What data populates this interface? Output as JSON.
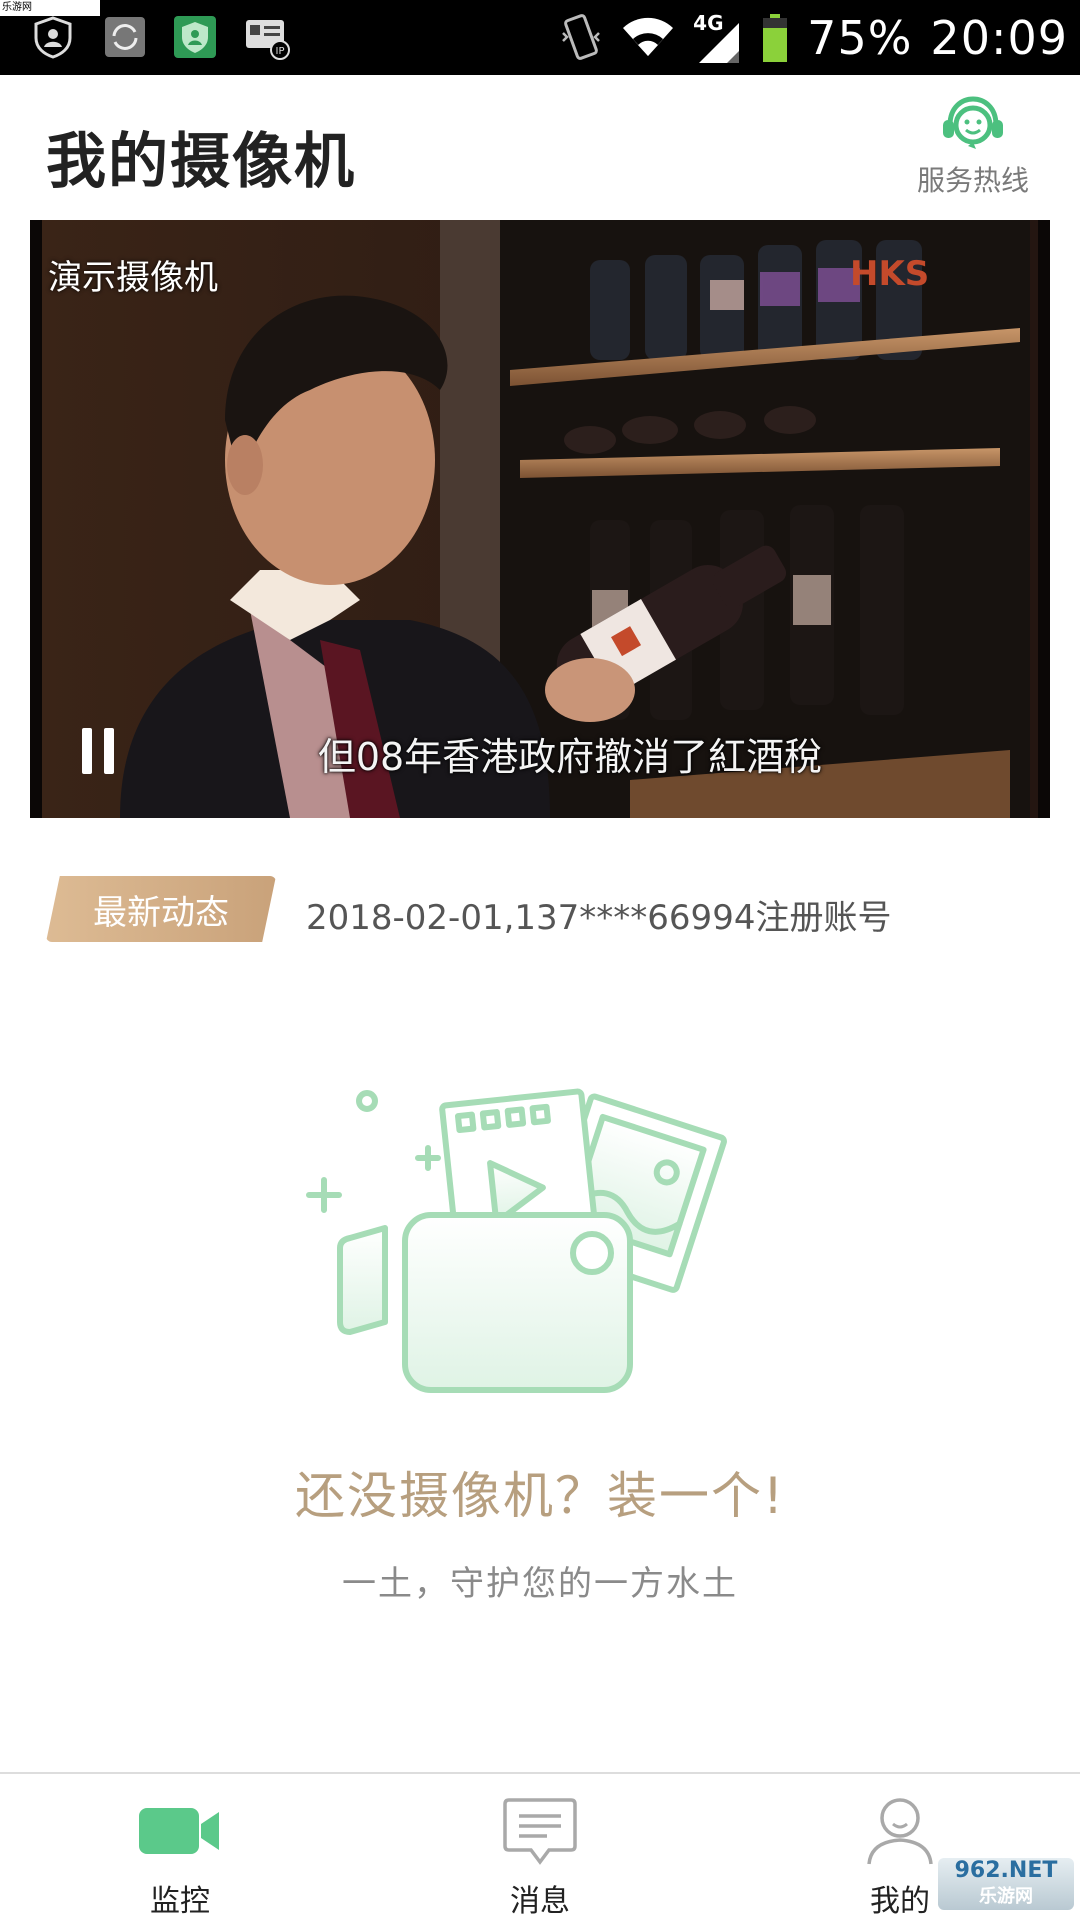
{
  "status_bar": {
    "watermark": "乐游网 www.962.net",
    "network": "4G",
    "battery": "75%",
    "time": "20:09"
  },
  "header": {
    "title": "我的摄像机",
    "hotline_label": "服务热线"
  },
  "video": {
    "camera_name": "演示摄像机",
    "subtitle": "但08年香港政府撤消了紅酒稅",
    "channel_logo": "HKS"
  },
  "news": {
    "badge": "最新动态",
    "text": "2018-02-01,137****66994注册账号"
  },
  "empty_state": {
    "title": "还没摄像机？装一个!",
    "subtitle": "一土，守护您的一方水土"
  },
  "bottom_nav": {
    "items": [
      {
        "label": "监控",
        "icon": "camera-icon",
        "active": true
      },
      {
        "label": "消息",
        "icon": "message-icon",
        "active": false
      },
      {
        "label": "我的",
        "icon": "user-icon",
        "active": false
      }
    ]
  },
  "corner_watermark": {
    "brand": "962.NET",
    "name": "乐游网"
  },
  "colors": {
    "accent_green": "#5bc98a",
    "badge_gold": "#d3b089",
    "empty_title": "#b79f7f"
  }
}
